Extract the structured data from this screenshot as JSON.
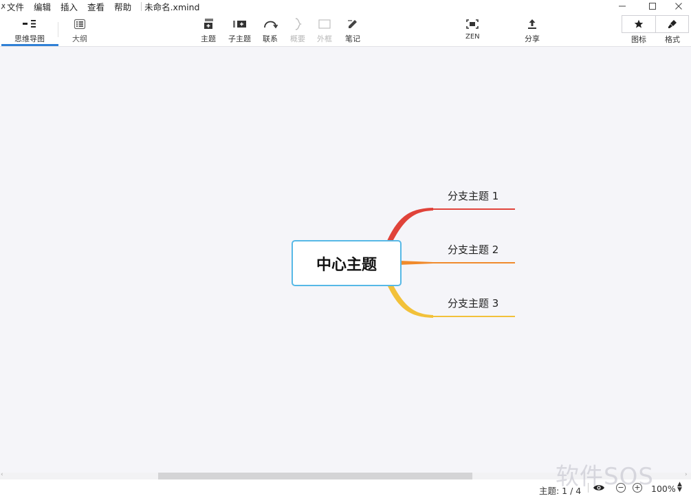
{
  "menu": {
    "items": [
      "文件",
      "编辑",
      "插入",
      "查看",
      "帮助"
    ],
    "document_title": "未命名.xmind"
  },
  "toolbar": {
    "view_tabs": [
      {
        "label": "思维导图",
        "icon": "mindmap-icon",
        "active": true
      },
      {
        "label": "大纲",
        "icon": "outline-icon",
        "active": false
      }
    ],
    "actions": [
      {
        "label": "主题",
        "icon": "topic-icon",
        "enabled": true
      },
      {
        "label": "子主题",
        "icon": "subtopic-icon",
        "enabled": true
      },
      {
        "label": "联系",
        "icon": "relationship-icon",
        "enabled": true
      },
      {
        "label": "概要",
        "icon": "summary-icon",
        "enabled": false
      },
      {
        "label": "外框",
        "icon": "boundary-icon",
        "enabled": false
      },
      {
        "label": "笔记",
        "icon": "note-icon",
        "enabled": true
      }
    ],
    "zen_label": "ZEN",
    "share_label": "分享",
    "icons_label": "图标",
    "format_label": "格式"
  },
  "mindmap": {
    "central_topic": "中心主题",
    "branches": [
      {
        "label": "分支主题 1",
        "color": "#e0433a"
      },
      {
        "label": "分支主题 2",
        "color": "#f08a2c"
      },
      {
        "label": "分支主题 3",
        "color": "#f2c13a"
      }
    ]
  },
  "status": {
    "topic_count": "主题: 1 / 4",
    "zoom": "100%"
  },
  "watermark": "软件SOS",
  "colors": {
    "accent": "#2f7fd6",
    "central_border": "#56b8e6",
    "canvas_bg": "#f5f5f9"
  }
}
